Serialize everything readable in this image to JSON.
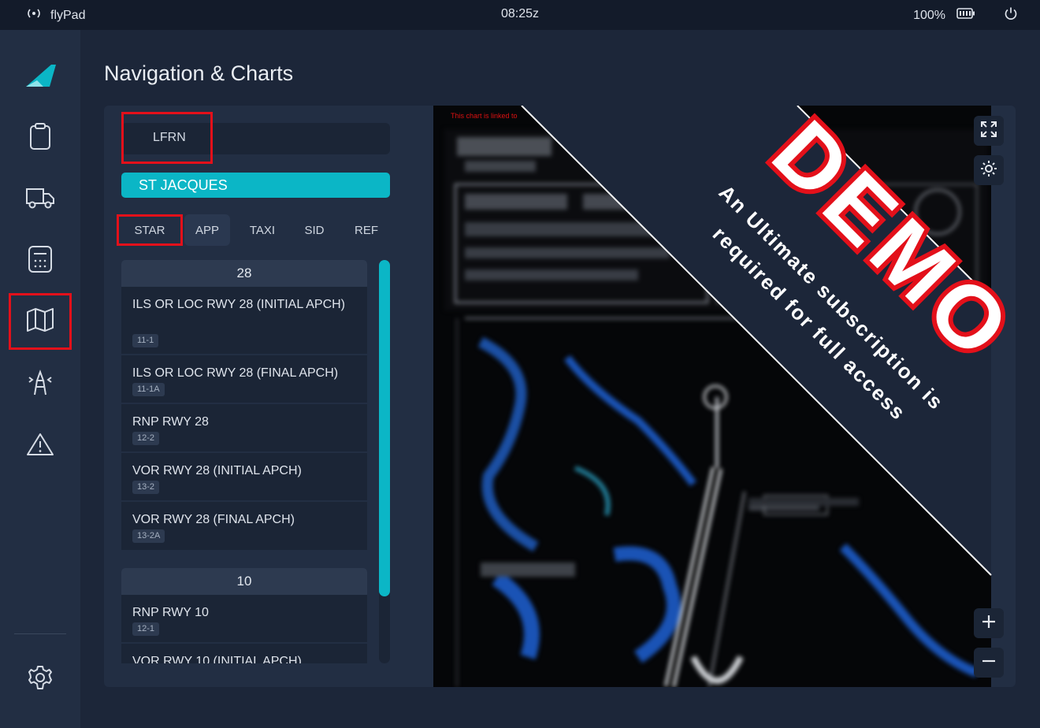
{
  "status_bar": {
    "app_name": "flyPad",
    "time": "08:25z",
    "battery": "100%"
  },
  "sidebar": {
    "items": [
      {
        "name": "logo",
        "icon": "flybywire-logo-icon"
      },
      {
        "name": "dispatch",
        "icon": "clipboard-icon"
      },
      {
        "name": "ground",
        "icon": "truck-icon"
      },
      {
        "name": "performance",
        "icon": "calculator-icon"
      },
      {
        "name": "navigation",
        "icon": "map-icon",
        "selected": true
      },
      {
        "name": "atc",
        "icon": "tower-icon"
      },
      {
        "name": "failures",
        "icon": "warning-icon"
      },
      {
        "name": "settings",
        "icon": "gear-icon"
      }
    ]
  },
  "page": {
    "title": "Navigation & Charts"
  },
  "nav_panel": {
    "icao_input_value": "LFRN",
    "airport_name": "ST JACQUES",
    "tabs": [
      "STAR",
      "APP",
      "TAXI",
      "SID",
      "REF"
    ],
    "selected_tab": "APP",
    "highlighted_tab": "STAR",
    "groups": [
      {
        "runway": "28",
        "charts": [
          {
            "name": "ILS OR LOC RWY 28 (INITIAL APCH)",
            "code": "11-1"
          },
          {
            "name": "ILS OR LOC RWY 28 (FINAL APCH)",
            "code": "11-1A"
          },
          {
            "name": "RNP RWY 28",
            "code": "12-2"
          },
          {
            "name": "VOR RWY 28 (INITIAL APCH)",
            "code": "13-2"
          },
          {
            "name": "VOR RWY 28 (FINAL APCH)",
            "code": "13-2A"
          }
        ]
      },
      {
        "runway": "10",
        "charts": [
          {
            "name": "RNP RWY 10",
            "code": "12-1"
          },
          {
            "name": "VOR RWY 10 (INITIAL APCH)",
            "code": ""
          }
        ]
      }
    ]
  },
  "viewer": {
    "chart_note": "This chart is linked to",
    "demo_word": "DEMO",
    "demo_line1": "An Ultimate subscription is",
    "demo_line2": "required for full access",
    "colors": {
      "accent": "#0bb6c6",
      "demo_red": "#e3101a",
      "banner": "#1c2639"
    }
  }
}
